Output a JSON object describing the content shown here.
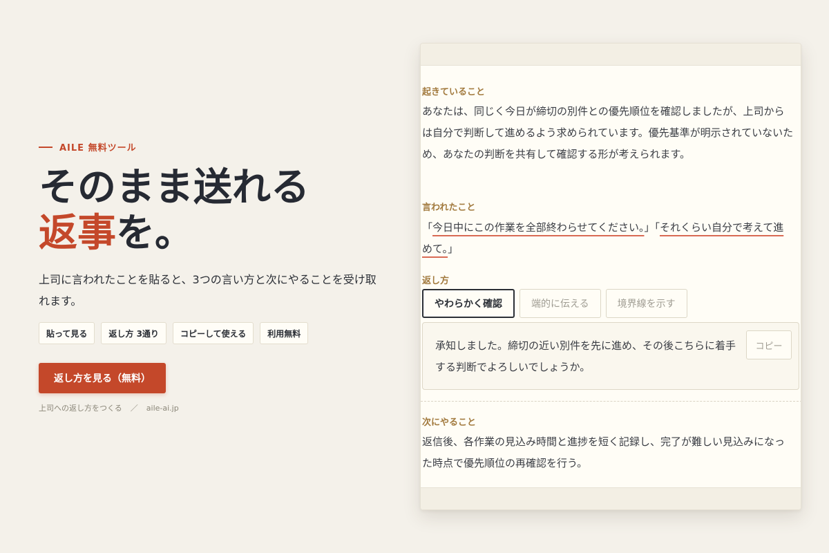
{
  "hero": {
    "eyebrow": "AILE 無料ツール",
    "headline_line1": "そのまま送れる",
    "headline_accent": "返事",
    "headline_rest": "を。",
    "lead": "上司に言われたことを貼ると、3つの言い方と次にやることを受け取れます。",
    "chips": [
      "貼って見る",
      "返し方 3通り",
      "コピーして使える",
      "利用無料"
    ],
    "cta": "返し方を見る（無料）",
    "footnote_left": "上司への返し方をつくる",
    "footnote_sep": "／",
    "footnote_right": "aile-ai.jp"
  },
  "panel": {
    "happening_label": "起きていること",
    "happening_text": "あなたは、同じく今日が締切の別件との優先順位を確認しましたが、上司からは自分で判断して進めるよう求められています。優先基準が明示されていないため、あなたの判断を共有して確認する形が考えられます。",
    "said_label": "言われたこと",
    "said_open1": "「",
    "said_quote1": "今日中にこの作業を全部終わらせてください。",
    "said_close1": "」",
    "said_open2": "「",
    "said_quote2": "それくらい自分で考えて進めて。",
    "said_close2": "」",
    "reply_label": "返し方",
    "tabs": [
      "やわらかく確認",
      "端的に伝える",
      "境界線を示す"
    ],
    "reply_text": "承知しました。締切の近い別件を先に進め、その後こちらに着手する判断でよろしいでしょうか。",
    "copy_label": "コピー",
    "next_label": "次にやること",
    "next_text": "返信後、各作業の見込み時間と進捗を短く記録し、完了が難しい見込みになった時点で優先順位の再確認を行う。"
  },
  "colors": {
    "background": "#f4f1ea",
    "accent": "#c4482a",
    "section_label": "#a27a3e",
    "text": "#2b2f36"
  }
}
